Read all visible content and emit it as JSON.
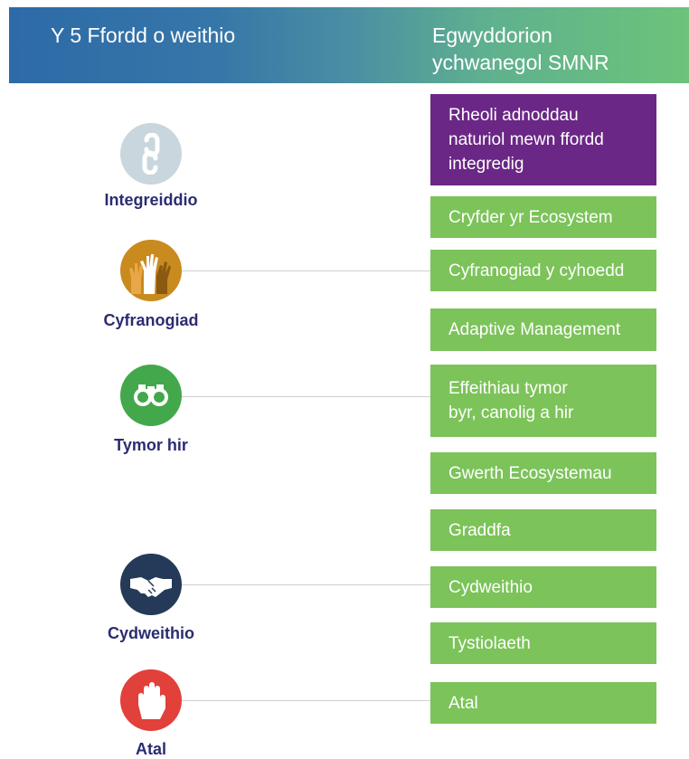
{
  "header": {
    "left_title": "Y 5 Ffordd o weithio",
    "right_title_line1": "Egwyddorion",
    "right_title_line2": "ychwanegol SMNR"
  },
  "ways": [
    {
      "label": "Integreiddio",
      "icon": "chain-link-icon",
      "color": "#c9d6de"
    },
    {
      "label": "Cyfranogiad",
      "icon": "raised-hands-icon",
      "color": "#c98a1e"
    },
    {
      "label": "Tymor hir",
      "icon": "binoculars-icon",
      "color": "#43a84b"
    },
    {
      "label": "Cydweithio",
      "icon": "handshake-icon",
      "color": "#243a58"
    },
    {
      "label": "Atal",
      "icon": "stop-hand-icon",
      "color": "#e2403a"
    }
  ],
  "principles": [
    {
      "line1": "Rheoli adnoddau",
      "line2": "naturiol mewn ffordd",
      "line3": "integredig",
      "color": "#6a2785"
    },
    {
      "line1": "Cryfder yr Ecosystem",
      "color": "#7cc35a"
    },
    {
      "line1": "Cyfranogiad y cyhoedd",
      "color": "#7cc35a"
    },
    {
      "line1": "Adaptive Management",
      "color": "#7cc35a"
    },
    {
      "line1": "Effeithiau tymor",
      "line2": "byr, canolig a hir",
      "color": "#7cc35a"
    },
    {
      "line1": "Gwerth Ecosystemau",
      "color": "#7cc35a"
    },
    {
      "line1": "Graddfa",
      "color": "#7cc35a"
    },
    {
      "line1": "Cydweithio",
      "color": "#7cc35a"
    },
    {
      "line1": "Tystiolaeth",
      "color": "#7cc35a"
    },
    {
      "line1": "Atal",
      "color": "#7cc35a"
    }
  ]
}
